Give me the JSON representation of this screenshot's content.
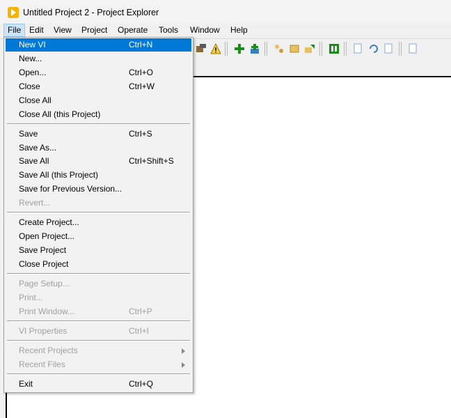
{
  "window": {
    "title": "Untitled Project 2 - Project Explorer"
  },
  "menubar": {
    "items": [
      {
        "label": "File",
        "active": true
      },
      {
        "label": "Edit"
      },
      {
        "label": "View"
      },
      {
        "label": "Project"
      },
      {
        "label": "Operate"
      },
      {
        "label": "Tools"
      },
      {
        "label": "Window"
      },
      {
        "label": "Help"
      }
    ]
  },
  "file_menu": {
    "groups": [
      [
        {
          "label": "New VI",
          "shortcut": "Ctrl+N",
          "highlighted": true
        },
        {
          "label": "New...",
          "shortcut": ""
        },
        {
          "label": "Open...",
          "shortcut": "Ctrl+O"
        },
        {
          "label": "Close",
          "shortcut": "Ctrl+W"
        },
        {
          "label": "Close All",
          "shortcut": ""
        },
        {
          "label": "Close All (this Project)",
          "shortcut": ""
        }
      ],
      [
        {
          "label": "Save",
          "shortcut": "Ctrl+S"
        },
        {
          "label": "Save As...",
          "shortcut": ""
        },
        {
          "label": "Save All",
          "shortcut": "Ctrl+Shift+S"
        },
        {
          "label": "Save All (this Project)",
          "shortcut": ""
        },
        {
          "label": "Save for Previous Version...",
          "shortcut": ""
        },
        {
          "label": "Revert...",
          "shortcut": "",
          "disabled": true
        }
      ],
      [
        {
          "label": "Create Project...",
          "shortcut": ""
        },
        {
          "label": "Open Project...",
          "shortcut": ""
        },
        {
          "label": "Save Project",
          "shortcut": ""
        },
        {
          "label": "Close Project",
          "shortcut": ""
        }
      ],
      [
        {
          "label": "Page Setup...",
          "shortcut": "",
          "disabled": true
        },
        {
          "label": "Print...",
          "shortcut": "",
          "disabled": true
        },
        {
          "label": "Print Window...",
          "shortcut": "Ctrl+P",
          "disabled": true
        }
      ],
      [
        {
          "label": "VI Properties",
          "shortcut": "Ctrl+I",
          "disabled": true
        }
      ],
      [
        {
          "label": "Recent Projects",
          "shortcut": "",
          "disabled": true,
          "submenu": true
        },
        {
          "label": "Recent Files",
          "shortcut": "",
          "disabled": true,
          "submenu": true
        }
      ],
      [
        {
          "label": "Exit",
          "shortcut": "Ctrl+Q"
        }
      ]
    ]
  },
  "colors": {
    "highlight": "#0078d7",
    "menu_background": "#f2f2f2",
    "disabled_text": "#a0a0a0",
    "app_icon": "#f5b400"
  },
  "toolbar": {
    "icons": [
      "project-settings-icon",
      "warning-icon",
      "add-item-icon",
      "add-folder-icon",
      "build-icon",
      "deploy-icon",
      "export-icon",
      "run-icon",
      "file-check-icon",
      "undo-icon",
      "file-up-icon",
      "file-add-icon"
    ]
  }
}
